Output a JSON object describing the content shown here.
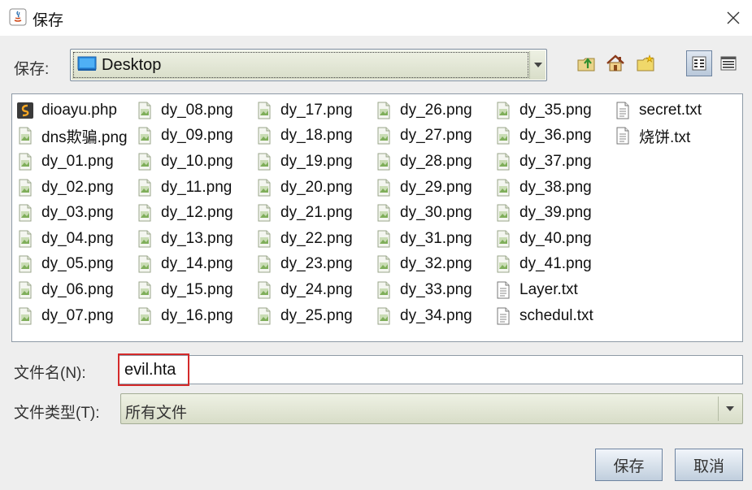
{
  "window": {
    "title": "保存",
    "app_icon": "java-icon",
    "close_icon": "close-icon"
  },
  "lookin": {
    "label": "保存:",
    "value": "Desktop",
    "icon": "desktop-folder-icon"
  },
  "toolbar": {
    "buttons": [
      "up-one-level-icon",
      "home-icon",
      "new-folder-icon",
      "list-view-icon",
      "details-view-icon"
    ]
  },
  "files": [
    {
      "name": "dioayu.php",
      "icon": "php-file-icon"
    },
    {
      "name": "dns欺骗.png",
      "icon": "png-file-icon"
    },
    {
      "name": "dy_01.png",
      "icon": "png-file-icon"
    },
    {
      "name": "dy_02.png",
      "icon": "png-file-icon"
    },
    {
      "name": "dy_03.png",
      "icon": "png-file-icon"
    },
    {
      "name": "dy_04.png",
      "icon": "png-file-icon"
    },
    {
      "name": "dy_05.png",
      "icon": "png-file-icon"
    },
    {
      "name": "dy_06.png",
      "icon": "png-file-icon"
    },
    {
      "name": "dy_07.png",
      "icon": "png-file-icon"
    },
    {
      "name": "dy_08.png",
      "icon": "png-file-icon"
    },
    {
      "name": "dy_09.png",
      "icon": "png-file-icon"
    },
    {
      "name": "dy_10.png",
      "icon": "png-file-icon"
    },
    {
      "name": "dy_11.png",
      "icon": "png-file-icon"
    },
    {
      "name": "dy_12.png",
      "icon": "png-file-icon"
    },
    {
      "name": "dy_13.png",
      "icon": "png-file-icon"
    },
    {
      "name": "dy_14.png",
      "icon": "png-file-icon"
    },
    {
      "name": "dy_15.png",
      "icon": "png-file-icon"
    },
    {
      "name": "dy_16.png",
      "icon": "png-file-icon"
    },
    {
      "name": "dy_17.png",
      "icon": "png-file-icon"
    },
    {
      "name": "dy_18.png",
      "icon": "png-file-icon"
    },
    {
      "name": "dy_19.png",
      "icon": "png-file-icon"
    },
    {
      "name": "dy_20.png",
      "icon": "png-file-icon"
    },
    {
      "name": "dy_21.png",
      "icon": "png-file-icon"
    },
    {
      "name": "dy_22.png",
      "icon": "png-file-icon"
    },
    {
      "name": "dy_23.png",
      "icon": "png-file-icon"
    },
    {
      "name": "dy_24.png",
      "icon": "png-file-icon"
    },
    {
      "name": "dy_25.png",
      "icon": "png-file-icon"
    },
    {
      "name": "dy_26.png",
      "icon": "png-file-icon"
    },
    {
      "name": "dy_27.png",
      "icon": "png-file-icon"
    },
    {
      "name": "dy_28.png",
      "icon": "png-file-icon"
    },
    {
      "name": "dy_29.png",
      "icon": "png-file-icon"
    },
    {
      "name": "dy_30.png",
      "icon": "png-file-icon"
    },
    {
      "name": "dy_31.png",
      "icon": "png-file-icon"
    },
    {
      "name": "dy_32.png",
      "icon": "png-file-icon"
    },
    {
      "name": "dy_33.png",
      "icon": "png-file-icon"
    },
    {
      "name": "dy_34.png",
      "icon": "png-file-icon"
    },
    {
      "name": "dy_35.png",
      "icon": "png-file-icon"
    },
    {
      "name": "dy_36.png",
      "icon": "png-file-icon"
    },
    {
      "name": "dy_37.png",
      "icon": "png-file-icon"
    },
    {
      "name": "dy_38.png",
      "icon": "png-file-icon"
    },
    {
      "name": "dy_39.png",
      "icon": "png-file-icon"
    },
    {
      "name": "dy_40.png",
      "icon": "png-file-icon"
    },
    {
      "name": "dy_41.png",
      "icon": "png-file-icon"
    },
    {
      "name": "Layer.txt",
      "icon": "txt-file-icon"
    },
    {
      "name": "schedul.txt",
      "icon": "txt-file-icon"
    },
    {
      "name": "secret.txt",
      "icon": "txt-file-icon"
    },
    {
      "name": "烧饼.txt",
      "icon": "txt-file-icon"
    }
  ],
  "filename": {
    "label": "文件名(N):",
    "value": "evil.hta",
    "highlight_color": "#d42a2a"
  },
  "filetype": {
    "label": "文件类型(T):",
    "value": "所有文件"
  },
  "buttons": {
    "save": "保存",
    "cancel": "取消"
  }
}
